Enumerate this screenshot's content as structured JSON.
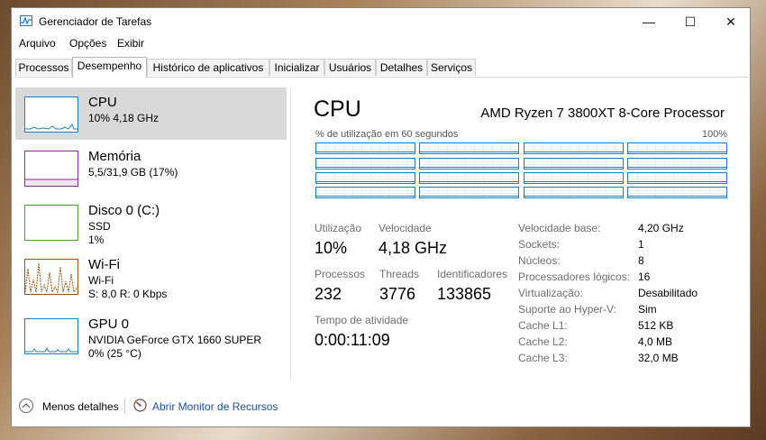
{
  "window": {
    "title": "Gerenciador de Tarefas",
    "min_glyph": "—",
    "max_glyph": "☐",
    "close_glyph": "✕"
  },
  "menu": [
    "Arquivo",
    "Opções",
    "Exibir"
  ],
  "tabs": [
    "Processos",
    "Desempenho",
    "Histórico de aplicativos",
    "Inicializar",
    "Usuários",
    "Detalhes",
    "Serviços"
  ],
  "active_tab": "Desempenho",
  "resources": [
    {
      "name": "CPU",
      "lines": [
        "10% 4,18 GHz"
      ],
      "color": "#1a82c4",
      "selected": true
    },
    {
      "name": "Memória",
      "lines": [
        "5,5/31,9 GB (17%)"
      ],
      "color": "#8b2c9f",
      "selected": false
    },
    {
      "name": "Disco 0 (C:)",
      "lines": [
        "SSD",
        "1%"
      ],
      "color": "#4aa02c",
      "selected": false
    },
    {
      "name": "Wi-Fi",
      "lines": [
        "Wi-Fi",
        "S: 8,0  R: 0 Kbps"
      ],
      "color": "#a74f0e",
      "selected": false
    },
    {
      "name": "GPU 0",
      "lines": [
        "NVIDIA GeForce GTX 1660 SUPER",
        "0% (25 °C)"
      ],
      "color": "#1a82c4",
      "selected": false
    }
  ],
  "detail": {
    "title": "CPU",
    "model": "AMD Ryzen 7 3800XT 8-Core Processor",
    "graph_label": "% de utilização em 60 segundos",
    "graph_max": "100%",
    "stats": {
      "utilization_label": "Utilização",
      "utilization": "10%",
      "speed_label": "Velocidade",
      "speed": "4,18 GHz",
      "processes_label": "Processos",
      "processes": "232",
      "threads_label": "Threads",
      "threads": "3776",
      "handles_label": "Identificadores",
      "handles": "133865",
      "uptime_label": "Tempo de atividade",
      "uptime": "0:00:11:09"
    },
    "specs": [
      {
        "label": "Velocidade base:",
        "value": "4,20 GHz"
      },
      {
        "label": "Sockets:",
        "value": "1"
      },
      {
        "label": "Núcleos:",
        "value": "8"
      },
      {
        "label": "Processadores lógicos:",
        "value": "16"
      },
      {
        "label": "Virtualização:",
        "value": "Desabilitado"
      },
      {
        "label": "Suporte ao Hyper-V:",
        "value": "Sim"
      },
      {
        "label": "Cache L1:",
        "value": "512 KB"
      },
      {
        "label": "Cache L2:",
        "value": "4,0 MB"
      },
      {
        "label": "Cache L3:",
        "value": "32,0 MB"
      }
    ]
  },
  "footer": {
    "less_details": "Menos detalhes",
    "resource_monitor": "Abrir Monitor de Recursos"
  }
}
